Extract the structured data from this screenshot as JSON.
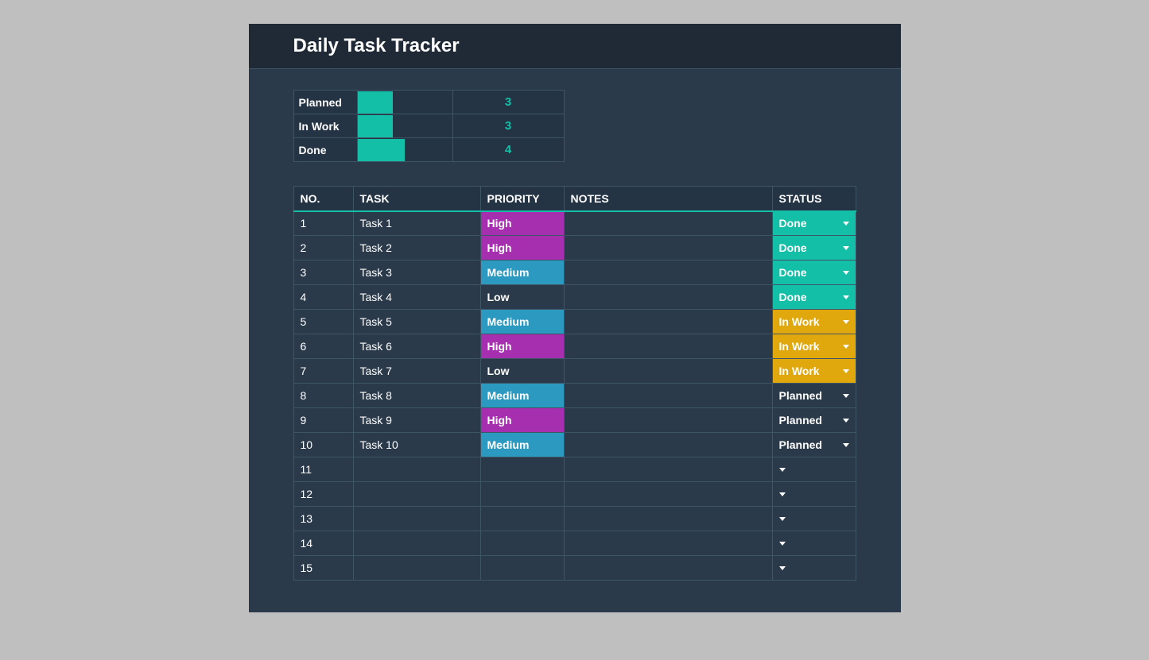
{
  "title": "Daily Task Tracker",
  "summary": {
    "rows": [
      {
        "label": "Planned",
        "count": "3",
        "barPct": 37
      },
      {
        "label": "In Work",
        "count": "3",
        "barPct": 37
      },
      {
        "label": "Done",
        "count": "4",
        "barPct": 50
      }
    ]
  },
  "columns": {
    "no": "NO.",
    "task": "TASK",
    "priority": "PRIORITY",
    "notes": "NOTES",
    "status": "STATUS"
  },
  "tasks": [
    {
      "no": "1",
      "task": "Task 1",
      "priority": "High",
      "notes": "",
      "status": "Done"
    },
    {
      "no": "2",
      "task": "Task 2",
      "priority": "High",
      "notes": "",
      "status": "Done"
    },
    {
      "no": "3",
      "task": "Task 3",
      "priority": "Medium",
      "notes": "",
      "status": "Done"
    },
    {
      "no": "4",
      "task": "Task 4",
      "priority": "Low",
      "notes": "",
      "status": "Done"
    },
    {
      "no": "5",
      "task": "Task 5",
      "priority": "Medium",
      "notes": "",
      "status": "In Work"
    },
    {
      "no": "6",
      "task": "Task 6",
      "priority": "High",
      "notes": "",
      "status": "In Work"
    },
    {
      "no": "7",
      "task": "Task 7",
      "priority": "Low",
      "notes": "",
      "status": "In Work"
    },
    {
      "no": "8",
      "task": "Task 8",
      "priority": "Medium",
      "notes": "",
      "status": "Planned"
    },
    {
      "no": "9",
      "task": "Task 9",
      "priority": "High",
      "notes": "",
      "status": "Planned"
    },
    {
      "no": "10",
      "task": "Task 10",
      "priority": "Medium",
      "notes": "",
      "status": "Planned"
    },
    {
      "no": "11",
      "task": "",
      "priority": "",
      "notes": "",
      "status": ""
    },
    {
      "no": "12",
      "task": "",
      "priority": "",
      "notes": "",
      "status": ""
    },
    {
      "no": "13",
      "task": "",
      "priority": "",
      "notes": "",
      "status": ""
    },
    {
      "no": "14",
      "task": "",
      "priority": "",
      "notes": "",
      "status": ""
    },
    {
      "no": "15",
      "task": "",
      "priority": "",
      "notes": "",
      "status": ""
    }
  ],
  "colors": {
    "accent": "#13bfa6",
    "priorityHigh": "#a62fb0",
    "priorityMedium": "#2c9ac0",
    "statusDone": "#13bfa6",
    "statusInWork": "#e0a80d"
  }
}
